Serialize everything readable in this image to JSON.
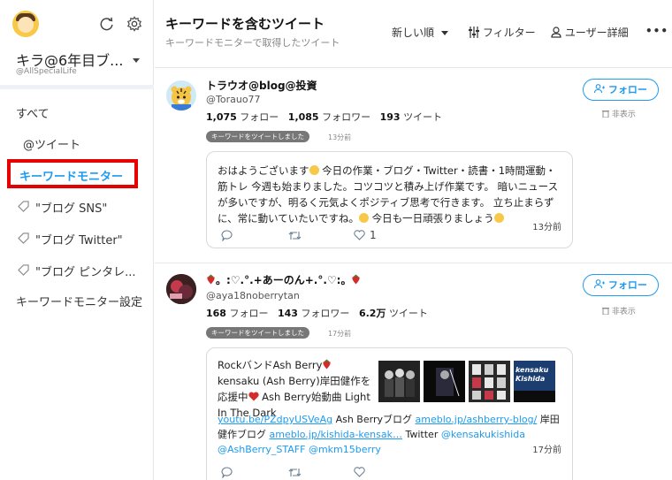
{
  "sidebar": {
    "account_name": "キラ@6年目ブ...",
    "account_handle": "@AllSpecialLife",
    "nav": {
      "all": "すべて",
      "tweets": "@ツイート",
      "keyword_monitor": "キーワードモニター",
      "kw1": "\"ブログ SNS\"",
      "kw2": "\"ブログ Twitter\"",
      "kw3": "\"ブログ ピンタレ...",
      "settings": "キーワードモニター設定"
    },
    "icons": [
      "refresh-icon",
      "gear-icon",
      "tag-icon"
    ]
  },
  "header": {
    "title": "キーワードを含むツイート",
    "subtitle": "キーワードモニターで取得したツイート",
    "sort": "新しい順",
    "filter": "フィルター",
    "user_detail": "ユーザー詳細",
    "more": "•••"
  },
  "tweets": [
    {
      "name": "トラウオ@blog@投資",
      "handle": "@Torauo77",
      "follow_count": "1,075",
      "follow_label": "フォロー",
      "follower_count": "1,085",
      "follower_label": "フォロワー",
      "tweet_count": "193",
      "tweet_label": "ツイート",
      "badge": "キーワードをツイートしました",
      "badge_time": "13分前",
      "follow_button": "フォロー",
      "hide": "非表示",
      "text_1": "おはようございます",
      "text_2": " 今日の作業・ブログ・Twitter・読書・1時間運動・筋トレ 今週も始まりました。コツコツと積み上げ作業です。 暗いニュースが多いですが、明るく元気よくポジティブ思考で行きます。 立ち止まらずに、常に動いていたいですね。",
      "text_3": " 今日も一日頑張りましょう",
      "time": "13分前",
      "like_count": "1"
    },
    {
      "name": "。:♡.°.+あーのん+.°.♡:。",
      "handle": "@aya18noberrytan",
      "follow_count": "168",
      "follow_label": "フォロー",
      "follower_count": "143",
      "follower_label": "フォロワー",
      "tweet_count": "6.2万",
      "tweet_label": "ツイート",
      "badge": "キーワードをツイートしました",
      "badge_time": "17分前",
      "follow_button": "フォロー",
      "hide": "非表示",
      "text_a": "RockバンドAsh Berry",
      "text_b": "kensaku (Ash Berry)岸田健作を",
      "text_c": "応援中",
      "text_d": " Ash Berry始動曲 Light In The Dark",
      "link_1": "youtu.be/PZdpyUSVeAg",
      "text_e": " Ash Berryブログ ",
      "link_2": "ameblo.jp/ashberry-blog/",
      "text_f": " 岸田健作ブログ ",
      "link_3": "ameblo.jp/kishida-kensak…",
      "text_g": " Twitter ",
      "mention_1": "@kensakukishida",
      "mention_2": "@AshBerry_STAFF",
      "mention_3": "@mkm15berry",
      "time": "17分前",
      "thumb_4_text": "kensaku Kishida"
    }
  ]
}
